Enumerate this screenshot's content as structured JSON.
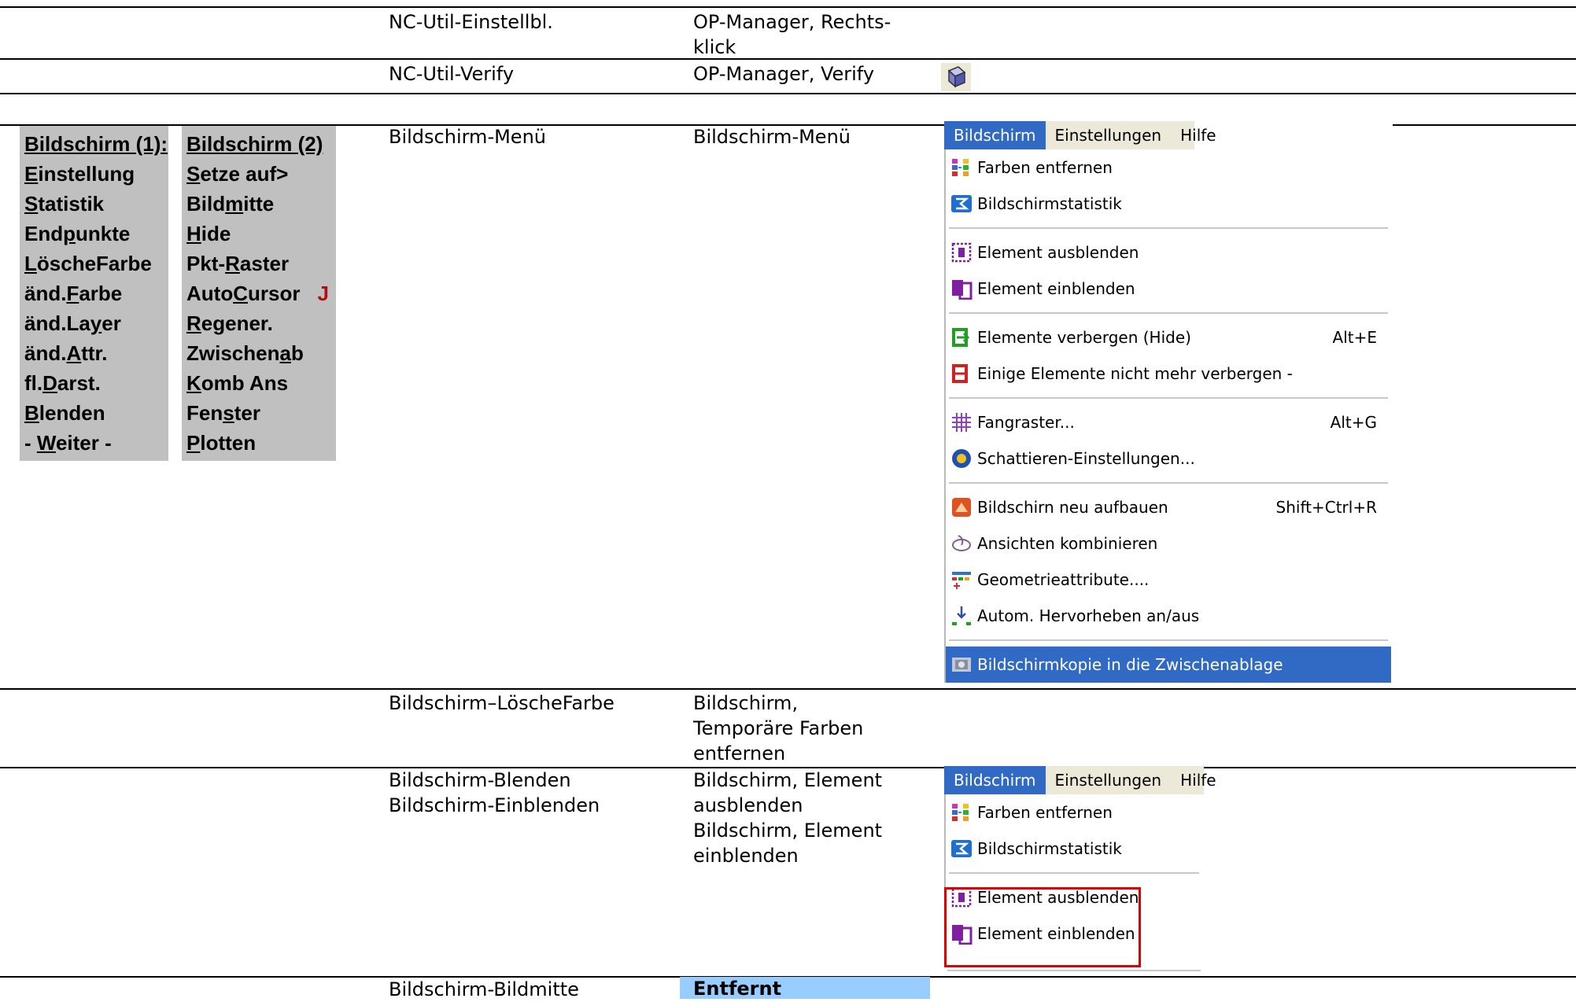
{
  "rows": {
    "r1": {
      "cmd": "NC-Util-Einstellbl.",
      "path": [
        "OP-Manager, Rechts-",
        "klick"
      ]
    },
    "r2": {
      "cmd": "NC-Util-Verify",
      "path": [
        "OP-Manager, Verify"
      ],
      "icon": "verify-cube-icon"
    },
    "r3": {
      "cmd": "Bildschirm-Menü",
      "path": [
        "Bildschirm-Menü"
      ]
    },
    "r4": {
      "cmd": "Bildschirm–LöscheFarbe",
      "path": [
        "Bildschirm,",
        "Temporäre Farben",
        "entfernen"
      ]
    },
    "r5": {
      "cmd": [
        "Bildschirm-Blenden",
        "Bildschirm-Einblenden"
      ],
      "path": [
        "Bildschirm, Element",
        "ausblenden",
        "Bildschirm, Element",
        "einblenden"
      ]
    },
    "r6": {
      "cmd": "Bildschirm-Bildmitte",
      "path": "Entfernt"
    }
  },
  "old_menu_1": {
    "title": "Bildschirm (1):",
    "items": [
      {
        "pre": "",
        "hk": "E",
        "post": "instellung"
      },
      {
        "pre": "",
        "hk": "S",
        "post": "tatistik"
      },
      {
        "pre": "End",
        "hk": "p",
        "post": "unkte"
      },
      {
        "pre": "",
        "hk": "L",
        "post": "öscheFarbe"
      },
      {
        "pre": "änd.",
        "hk": "F",
        "post": "arbe"
      },
      {
        "pre": "änd.La",
        "hk": "y",
        "post": "er"
      },
      {
        "pre": "änd.",
        "hk": "A",
        "post": "ttr."
      },
      {
        "pre": "fl.",
        "hk": "D",
        "post": "arst."
      },
      {
        "pre": "",
        "hk": "B",
        "post": "lenden"
      },
      {
        "pre": "- ",
        "hk": "W",
        "post": "eiter -"
      }
    ]
  },
  "old_menu_2": {
    "title": "Bildschirm (2)",
    "items": [
      {
        "pre": "",
        "hk": "S",
        "post": "etze auf>"
      },
      {
        "pre": "Bild",
        "hk": "m",
        "post": "itte"
      },
      {
        "pre": "",
        "hk": "H",
        "post": "ide"
      },
      {
        "pre": "Pkt-",
        "hk": "R",
        "post": "aster"
      },
      {
        "pre": "Auto",
        "hk": "C",
        "post": "ursor",
        "mark": "J"
      },
      {
        "pre": "",
        "hk": "R",
        "post": "egener."
      },
      {
        "pre": "Zwischen",
        "hk": "a",
        "post": "b"
      },
      {
        "pre": "",
        "hk": "K",
        "post": "omb Ans"
      },
      {
        "pre": "Fen",
        "hk": "s",
        "post": "ter"
      },
      {
        "pre": "",
        "hk": "P",
        "post": "lotten"
      }
    ]
  },
  "menubar": {
    "items": [
      "Bildschirm",
      "Einstellungen",
      "Hilfe"
    ]
  },
  "menu1_items": [
    {
      "label": "Farben entfernen",
      "icon": "remove-colors-icon"
    },
    {
      "label": "Bildschirmstatistik",
      "icon": "sigma-statistics-icon"
    },
    {
      "sep": true
    },
    {
      "label": "Element ausblenden",
      "icon": "hide-element-icon"
    },
    {
      "label": "Element einblenden",
      "icon": "show-element-icon"
    },
    {
      "sep": true
    },
    {
      "label": "Elemente verbergen (Hide)",
      "shortcut": "Alt+E",
      "icon": "hide-elements-green-icon"
    },
    {
      "label": "Einige Elemente nicht mehr verbergen -",
      "icon": "unhide-elements-red-icon"
    },
    {
      "sep": true
    },
    {
      "label": "Fangraster...",
      "shortcut": "Alt+G",
      "icon": "snap-grid-icon"
    },
    {
      "label": "Schattieren-Einstellungen...",
      "icon": "shading-settings-icon"
    },
    {
      "sep": true
    },
    {
      "label": "Bildschirn neu aufbauen",
      "shortcut": "Shift+Ctrl+R",
      "icon": "rebuild-screen-icon"
    },
    {
      "label": "Ansichten kombinieren",
      "icon": "combine-views-icon"
    },
    {
      "label": "Geometrieattribute....",
      "icon": "geometry-attributes-icon"
    },
    {
      "label": "Autom. Hervorheben an/aus",
      "icon": "auto-highlight-icon"
    },
    {
      "sep": true
    },
    {
      "label": "Bildschirmkopie in die Zwischenablage",
      "icon": "screenshot-clipboard-icon",
      "highlighted": true
    }
  ],
  "menu2_items": [
    {
      "label": "Farben entfernen",
      "icon": "remove-colors-icon"
    },
    {
      "label": "Bildschirmstatistik",
      "icon": "sigma-statistics-icon"
    },
    {
      "sep": true
    },
    {
      "label": "Element ausblenden",
      "icon": "hide-element-icon"
    },
    {
      "label": "Element einblenden",
      "icon": "show-element-icon"
    }
  ],
  "colors": {
    "menu_highlight": "#316ac5",
    "redbox": "#e00000",
    "removed_bg": "#99ccff"
  }
}
